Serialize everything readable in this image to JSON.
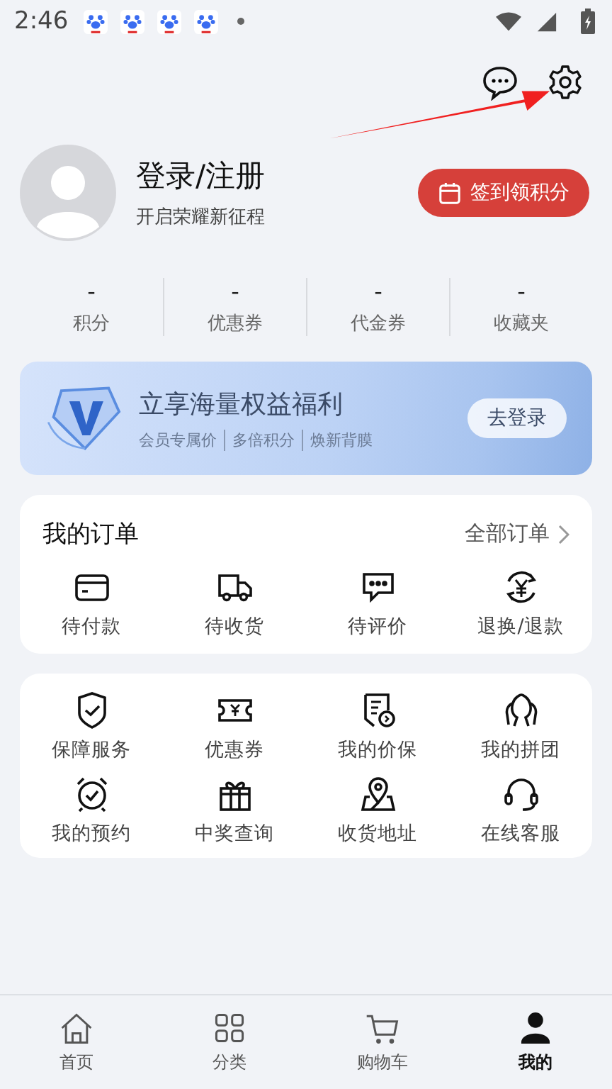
{
  "status_bar": {
    "time": "2:46"
  },
  "profile": {
    "name": "登录/注册",
    "subtitle": "开启荣耀新征程",
    "checkin": "签到领积分"
  },
  "stats": [
    {
      "value": "-",
      "label": "积分"
    },
    {
      "value": "-",
      "label": "优惠券"
    },
    {
      "value": "-",
      "label": "代金券"
    },
    {
      "value": "-",
      "label": "收藏夹"
    }
  ],
  "banner": {
    "title": "立享海量权益福利",
    "perks": [
      "会员专属价",
      "多倍积分",
      "焕新背膜"
    ],
    "button": "去登录"
  },
  "orders": {
    "title": "我的订单",
    "all_link": "全部订单",
    "items": [
      {
        "kind": "card",
        "label": "待付款"
      },
      {
        "kind": "truck",
        "label": "待收货"
      },
      {
        "kind": "comment",
        "label": "待评价"
      },
      {
        "kind": "refund",
        "label": "退换/退款"
      }
    ]
  },
  "services": [
    {
      "kind": "shield",
      "label": "保障服务"
    },
    {
      "kind": "ticket",
      "label": "优惠券"
    },
    {
      "kind": "price",
      "label": "我的价保"
    },
    {
      "kind": "group",
      "label": "我的拼团"
    },
    {
      "kind": "alarm",
      "label": "我的预约"
    },
    {
      "kind": "gift",
      "label": "中奖查询"
    },
    {
      "kind": "pin",
      "label": "收货地址"
    },
    {
      "kind": "headset",
      "label": "在线客服"
    }
  ],
  "tabs": [
    {
      "kind": "home",
      "label": "首页",
      "selected": false
    },
    {
      "kind": "grid",
      "label": "分类",
      "selected": false
    },
    {
      "kind": "cart",
      "label": "购物车",
      "selected": false
    },
    {
      "kind": "user",
      "label": "我的",
      "selected": true
    }
  ]
}
